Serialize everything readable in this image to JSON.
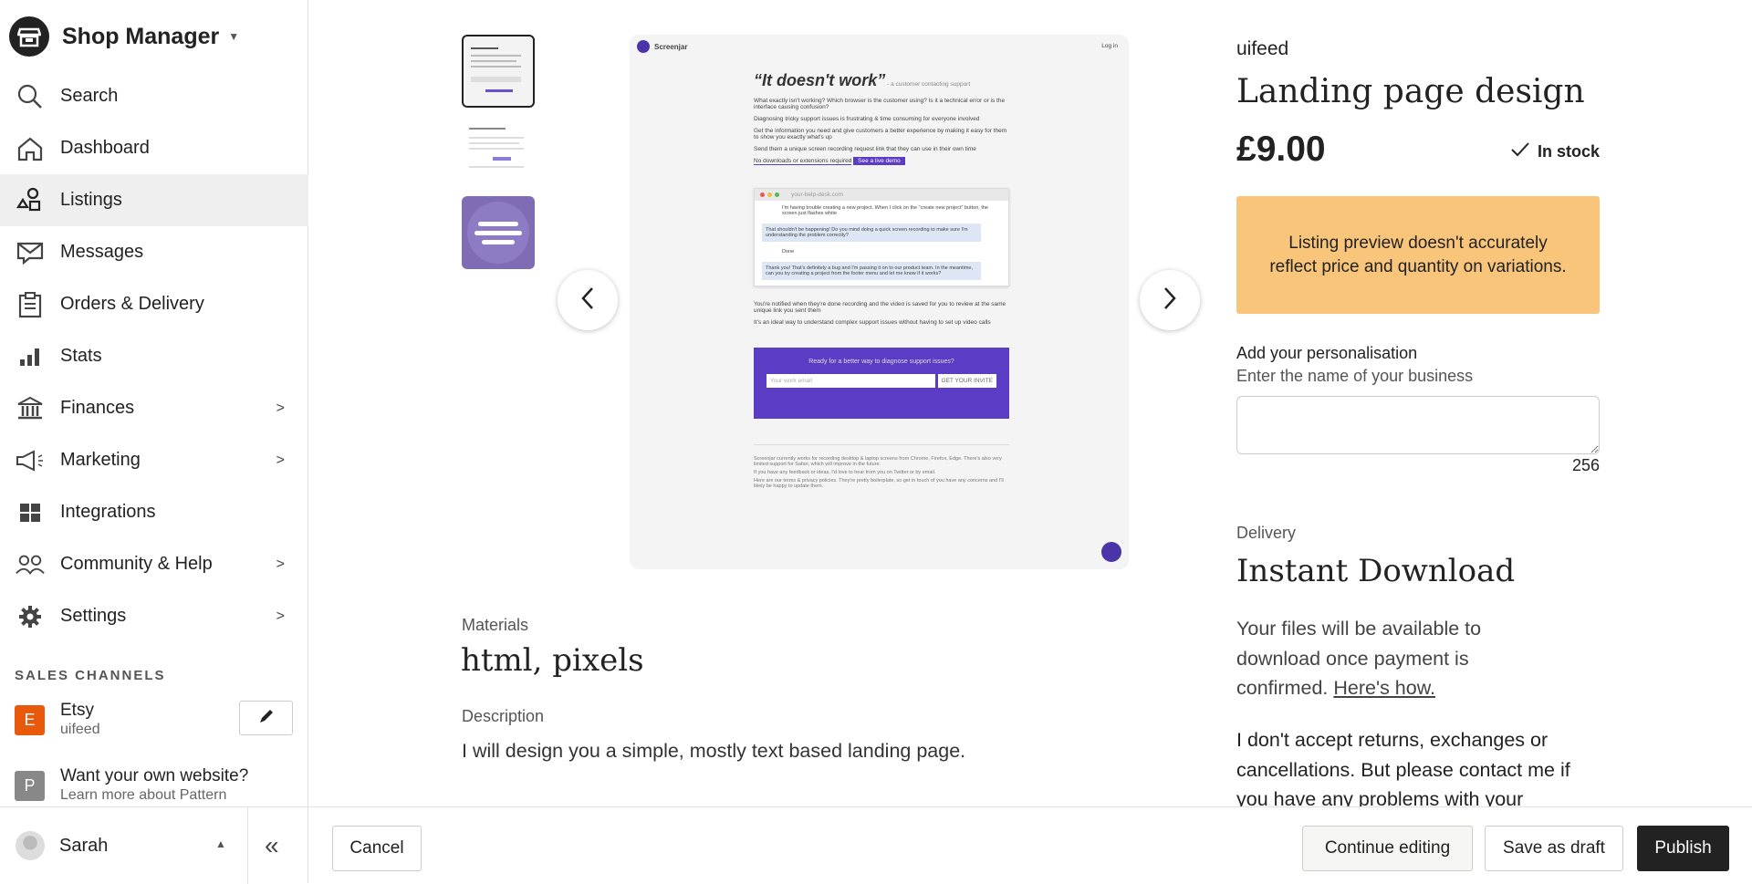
{
  "app": {
    "title": "Shop Manager"
  },
  "sidebar": {
    "items": [
      {
        "label": "Search",
        "icon": "search-icon"
      },
      {
        "label": "Dashboard",
        "icon": "home-icon"
      },
      {
        "label": "Listings",
        "icon": "shapes-icon",
        "active": true
      },
      {
        "label": "Messages",
        "icon": "envelope-icon"
      },
      {
        "label": "Orders & Delivery",
        "icon": "clipboard-icon"
      },
      {
        "label": "Stats",
        "icon": "bar-chart-icon"
      },
      {
        "label": "Finances",
        "icon": "bank-icon",
        "chevron": true
      },
      {
        "label": "Marketing",
        "icon": "megaphone-icon",
        "chevron": true
      },
      {
        "label": "Integrations",
        "icon": "grid-icon"
      },
      {
        "label": "Community & Help",
        "icon": "people-icon",
        "chevron": true
      },
      {
        "label": "Settings",
        "icon": "gear-icon",
        "chevron": true
      }
    ],
    "sales_channels_heading": "SALES CHANNELS",
    "channels": [
      {
        "badge": "E",
        "name": "Etsy",
        "sub": "uifeed",
        "color": "#e8590c"
      },
      {
        "badge": "P",
        "name": "Want your own website?",
        "sub": "Learn more about Pattern",
        "color": "#888888"
      }
    ],
    "user": {
      "name": "Sarah"
    }
  },
  "preview": {
    "brand": "Screenjar",
    "login": "Log in",
    "headline": "“It doesn't work”",
    "attribution": "- a customer contacting support",
    "paragraphs": [
      "What exactly isn't working? Which browser is the customer using? Is it a technical error or is the interface causing confusion?",
      "Diagnosing tricky support issues is frustrating & time consuming for everyone involved",
      "Get the information you need and give customers a better experience by making it easy for them to show you exactly what's up",
      "Send them a unique screen recording request link that they can use in their own time"
    ],
    "no_downloads": "No downloads or extensions required",
    "demo_button": "See a live demo",
    "url": "your-help-desk.com",
    "chat": [
      "I'm having trouble creating a new project. When I click on the \"create new project\" button, the screen just flashes white",
      "That shouldn't be happening! Do you mind doing a quick screen recording to make sure I'm understanding the problem correctly?",
      "Done",
      "Thank you! That's definitely a bug and I'm passing it on to our product team. In the meantime, can you try creating a project from the footer menu and let me know if it works?"
    ],
    "after": [
      "You're notified when they're done recording and the video is saved for you to review at the same unique link you sent them",
      "It's an ideal way to understand complex support issues without having to set up video calls"
    ],
    "cta_title": "Ready for a better way to diagnose support issues?",
    "cta_placeholder": "Your work email",
    "cta_button": "GET YOUR INVITE",
    "footer": [
      "Screenjar currently works for recording desktop & laptop screens from Chrome, Firefox, Edge. There's also very limited support for Safari, which will improve in the future.",
      "If you have any feedback or ideas, I'd love to hear from you on Twitter or by email.",
      "Here are our terms & privacy policies. They're pretty boilerplate, so get in touch of you have any concerns and I'll likely be happy to update them."
    ],
    "accent": "#5b3cc4"
  },
  "listing": {
    "shop": "uifeed",
    "title": "Landing page design",
    "price": "£9.00",
    "stock": "In stock",
    "alert": "Listing preview doesn't accurately reflect price and quantity on variations.",
    "alert_color": "#f8c57a",
    "personalisation_label": "Add your personalisation",
    "personalisation_hint": "Enter the name of your business",
    "char_count": "256",
    "delivery_label": "Delivery",
    "delivery_title": "Instant Download",
    "delivery_text": "Your files will be available to download once payment is confirmed.",
    "delivery_link": "Here's how.",
    "returns_text": "I don't accept returns, exchanges or cancellations. But please contact me if you have any problems with your",
    "materials_label": "Materials",
    "materials": "html, pixels",
    "description_label": "Description",
    "description": "I will design you a simple, mostly text based landing page."
  },
  "actions": {
    "cancel": "Cancel",
    "continue": "Continue editing",
    "draft": "Save as draft",
    "publish": "Publish"
  }
}
